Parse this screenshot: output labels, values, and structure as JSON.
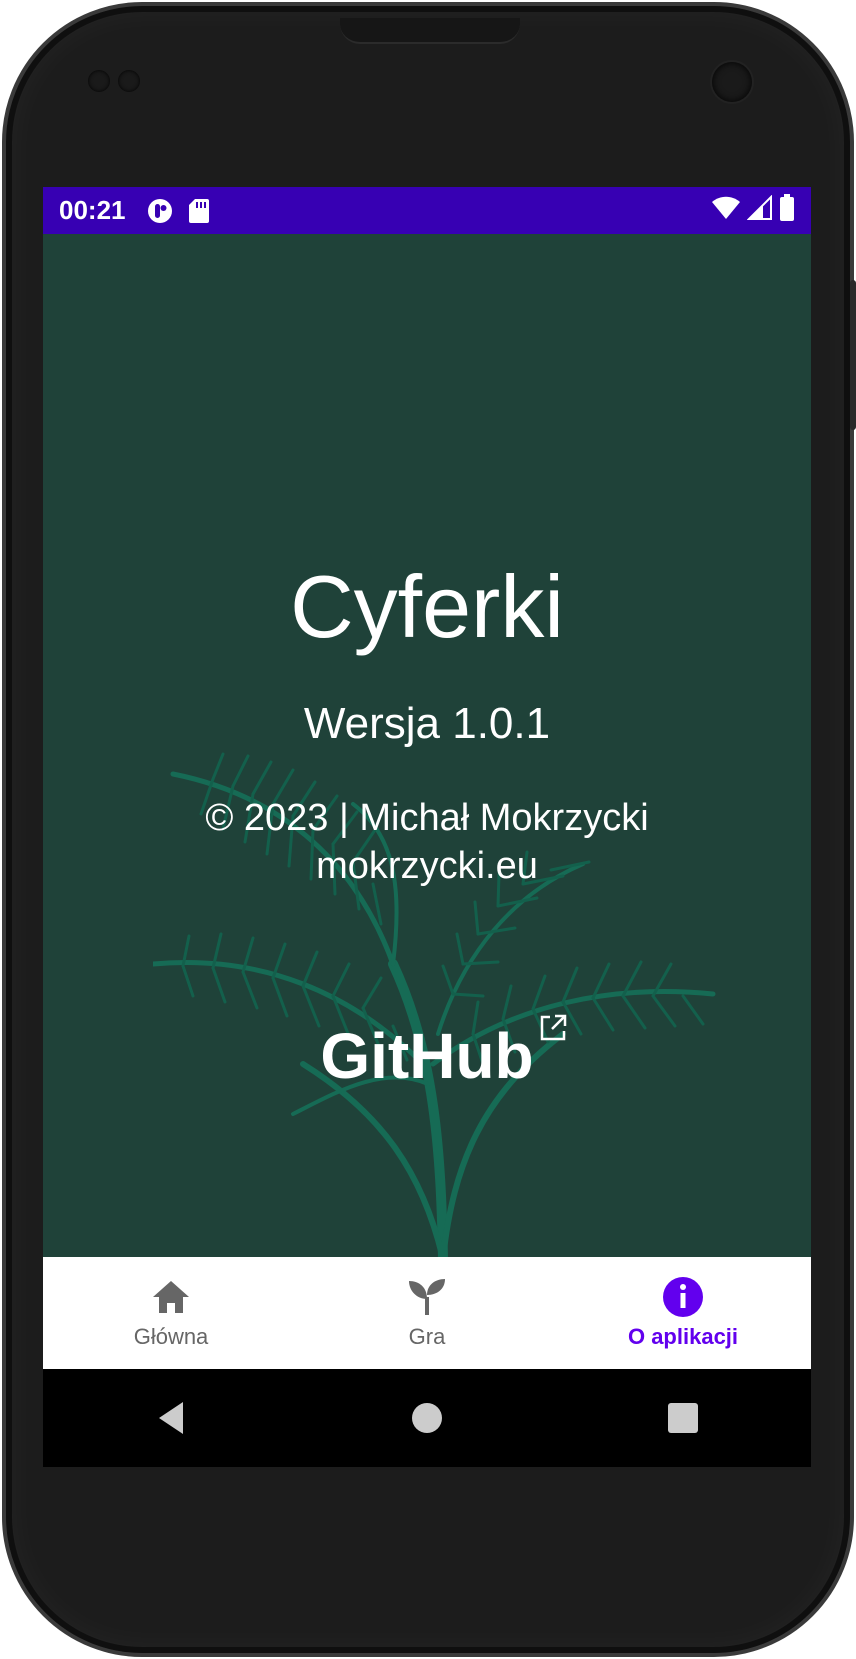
{
  "status_bar": {
    "time": "00:21",
    "icons": [
      "app-notification-icon",
      "sd-card-icon",
      "wifi-icon",
      "cellular-signal-icon",
      "battery-icon"
    ],
    "background": "#3700b3"
  },
  "about": {
    "app_title": "Cyferki",
    "version": "Wersja 1.0.1",
    "copyright": "© 2023 | Michał Mokrzycki",
    "website": "mokrzycki.eu",
    "github_link": "GitHub",
    "background": "#1f4239"
  },
  "bottom_nav": {
    "items": [
      {
        "label": "Główna",
        "icon": "home-icon",
        "active": false
      },
      {
        "label": "Gra",
        "icon": "sprout-icon",
        "active": false
      },
      {
        "label": "O aplikacji",
        "icon": "info-icon",
        "active": true
      }
    ],
    "active_color": "#6200ee",
    "inactive_color": "#666666"
  },
  "system_nav": {
    "buttons": [
      "back-icon",
      "home-circle-icon",
      "recents-icon"
    ]
  }
}
